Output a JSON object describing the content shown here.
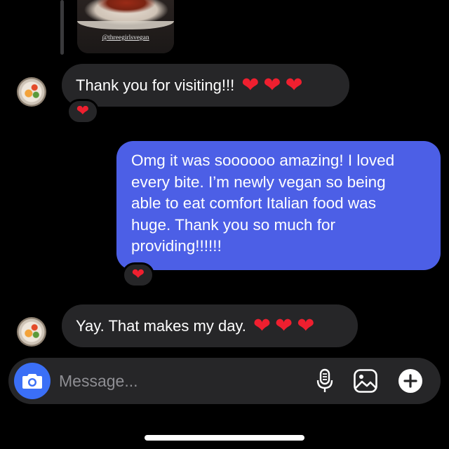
{
  "shared_post": {
    "credit": "@threegirlsvegan"
  },
  "messages": [
    {
      "direction": "incoming",
      "text": "Thank you for visiting!!!",
      "hearts": [
        "❤",
        "❤",
        "❤"
      ],
      "reaction": "❤"
    },
    {
      "direction": "outgoing",
      "lines": [
        "Omg it was soooooo amazing! I loved",
        "every bite. I’m newly vegan so being",
        "able to eat comfort Italian food was",
        "huge. Thank you so much for",
        "providing!!!!!!"
      ],
      "reaction": "❤"
    },
    {
      "direction": "incoming",
      "text": "Yay. That makes my day.",
      "hearts": [
        "❤",
        "❤",
        "❤"
      ]
    }
  ],
  "composer": {
    "placeholder": "Message...",
    "icons": {
      "camera": "camera-icon",
      "mic": "microphone-icon",
      "gallery": "image-gallery-icon",
      "plus": "plus-icon"
    }
  },
  "colors": {
    "background": "#000000",
    "incoming_bubble": "#262628",
    "outgoing_bubble": "#4c5fe6",
    "camera_button": "#3b6ff6",
    "heart": "#ef1f2f"
  }
}
